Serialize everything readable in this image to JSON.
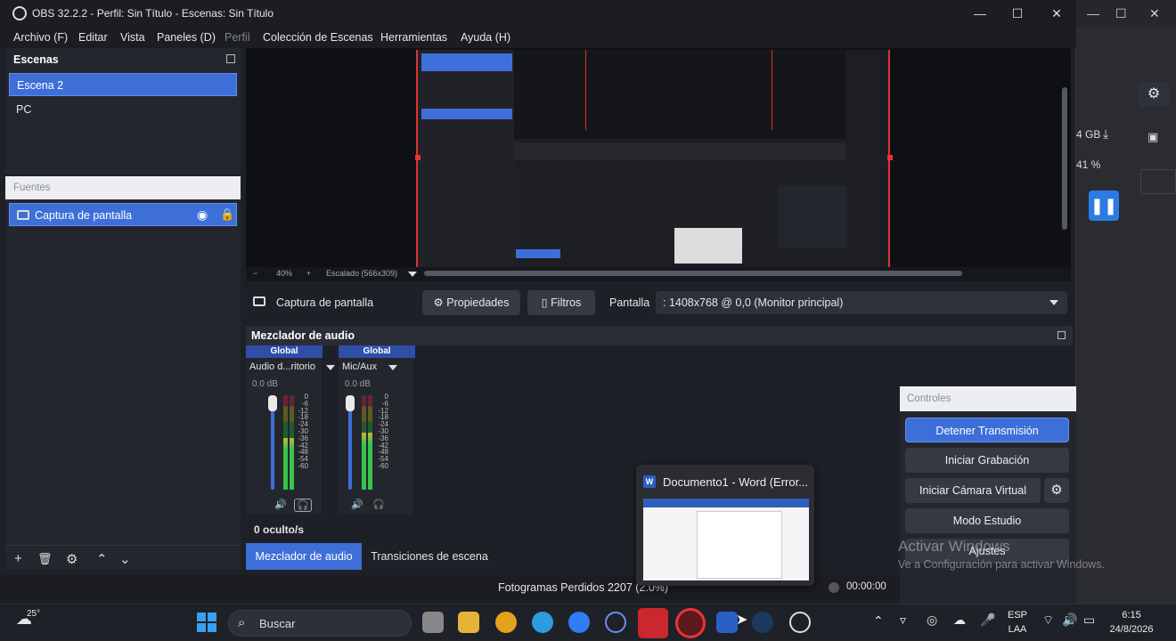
{
  "window": {
    "title": "OBS 32.2.2 - Perfil: Sin Título - Escenas: Sin Título",
    "min": "—",
    "max": "☐",
    "close": "✕"
  },
  "menu": {
    "archivo": "Archivo (F)",
    "editar": "Editar",
    "vista": "Vista",
    "paneles": "Paneles (D)",
    "perfil": "Perfil",
    "coleccion": "Colección de Escenas",
    "herramientas": "Herramientas",
    "ayuda": "Ayuda (H)"
  },
  "scenes": {
    "title": "Escenas",
    "items": [
      {
        "label": "Escena 2",
        "selected": true
      },
      {
        "label": "PC",
        "selected": false
      }
    ]
  },
  "sources": {
    "title": "Fuentes",
    "items": [
      {
        "label": "Captura de pantalla",
        "visible_icon": "eye-icon",
        "lock_icon": "lock-icon"
      }
    ]
  },
  "toolbar": {
    "add": "+",
    "remove": "🗑",
    "settings": "⚙",
    "up": "⌃",
    "down": "⌄"
  },
  "preview": {
    "zoom_out": "−",
    "zoom": "40%",
    "zoom_in": "+",
    "scale": "Escalado (566x309)"
  },
  "sourcebar": {
    "source_name": "Captura de pantalla",
    "properties": "Propiedades",
    "filters": "Filtros",
    "screen_label": "Pantalla",
    "screen_value": ": 1408x768 @ 0,0 (Monitor principal)"
  },
  "mixer": {
    "title": "Mezclador de audio",
    "channels": [
      {
        "global": "Global",
        "name": "Audio d...ritorio",
        "db": "0.0 dB",
        "level": 0.55
      },
      {
        "global": "Global",
        "name": "Mic/Aux",
        "db": "0.0 dB",
        "level": 0.6
      }
    ],
    "scale": [
      "0",
      "-6",
      "-12",
      "-18",
      "-24",
      "-30",
      "-36",
      "-42",
      "-48",
      "-54",
      "-60"
    ],
    "hidden": "0 oculto/s"
  },
  "tabs": {
    "mixer": "Mezclador de audio",
    "transitions": "Transiciones de escena"
  },
  "status": {
    "dropped": "Fotogramas Perdidos 2207 (2.0%)",
    "time": "00:00:00"
  },
  "controls": {
    "title": "Controles",
    "stop_stream": "Detener Transmisión",
    "start_recording": "Iniciar Grabación",
    "start_virtual_cam": "Iniciar Cámara Virtual",
    "studio_mode": "Modo Estudio",
    "settings": "Ajustes"
  },
  "thumbnail": {
    "title": "Documento1 - Word (Error..."
  },
  "watermark": {
    "line1": "Activar Windows",
    "line2": "Ve a Configuración para activar Windows."
  },
  "bg_window": {
    "storage": "4 GB",
    "percent": "41 %"
  },
  "taskbar": {
    "temperature": "25°",
    "search": "Buscar",
    "lang1": "ESP",
    "lang2": "LAA",
    "time": "6:15",
    "date": "24/8/2026"
  }
}
